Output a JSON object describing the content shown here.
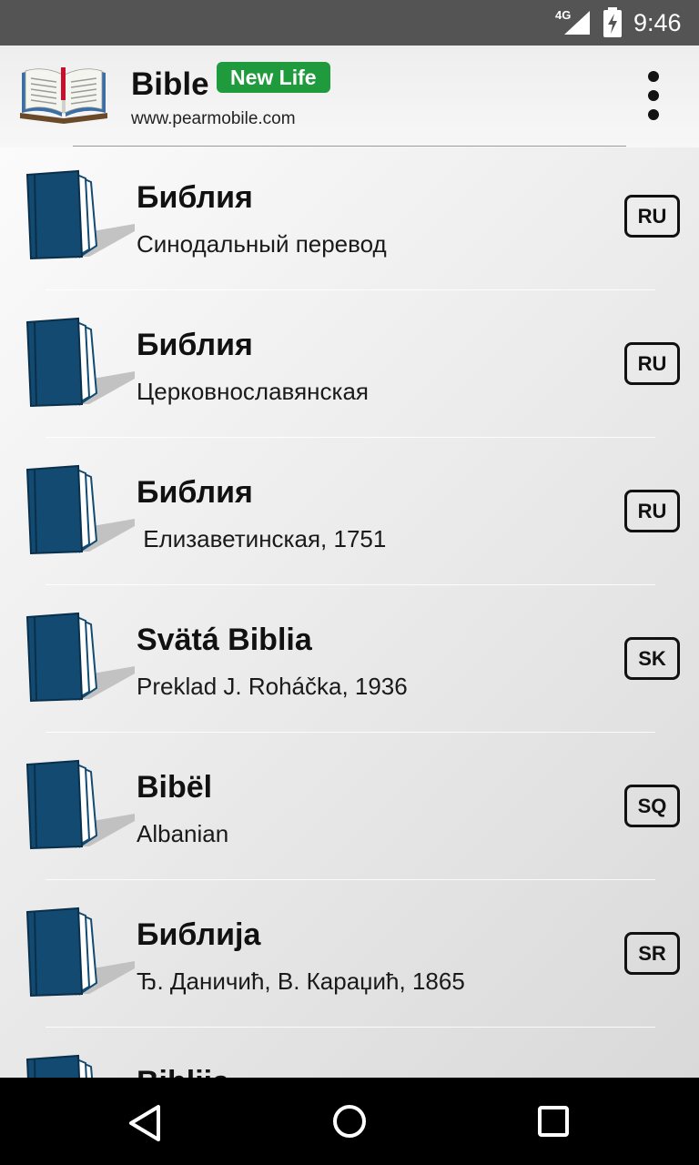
{
  "status_bar": {
    "network": "4G",
    "time": "9:46"
  },
  "header": {
    "title": "Bible",
    "badge": "New Life",
    "url": "www.pearmobile.com"
  },
  "colors": {
    "book_cover": "#124a72",
    "badge_green": "#1f9a3d",
    "status_bar": "#545454"
  },
  "items": [
    {
      "title": "Библия",
      "subtitle": "Синодальный перевод",
      "lang": "RU"
    },
    {
      "title": "Библия",
      "subtitle": "Церковнославянская",
      "lang": "RU"
    },
    {
      "title": "Библия",
      "subtitle": " Елизаветинская, 1751",
      "lang": "RU"
    },
    {
      "title": "Svätá Biblia",
      "subtitle": "Preklad J. Roháčka, 1936",
      "lang": "SK"
    },
    {
      "title": "Bibël",
      "subtitle": "Albanian",
      "lang": "SQ"
    },
    {
      "title": "Библија",
      "subtitle": "Ђ. Даничић, В. Караџић, 1865",
      "lang": "SR"
    },
    {
      "title": "Biblija",
      "subtitle": "",
      "lang": ""
    }
  ],
  "icons": {
    "app_logo": "open-bible-icon",
    "book": "closed-book-icon",
    "menu": "more-vert-icon",
    "nav_back": "back-triangle-icon",
    "nav_home": "home-circle-icon",
    "nav_recents": "recents-square-icon"
  }
}
